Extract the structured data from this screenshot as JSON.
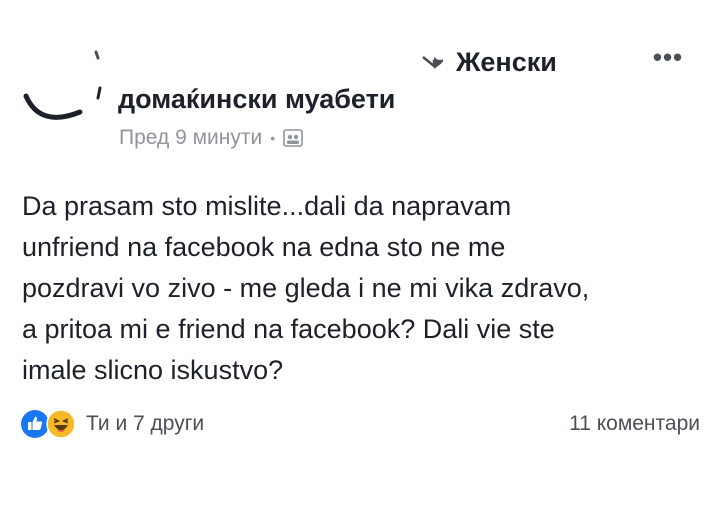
{
  "header": {
    "arrow_icon": "right-arrow-icon",
    "group_prefix": "Женски",
    "group_name": "домаќински муабети",
    "more_icon": "more-options-icon",
    "more_label": "•••"
  },
  "meta": {
    "time": "Пред 9 минути",
    "separator": "•",
    "audience_icon": "group-icon"
  },
  "post": {
    "text": "Da prasam sto mislite...dali da napravam\nunfriend na facebook na edna sto ne me\npozdravi vo zivo - me gleda i ne mi vika zdravo,\na pritoa mi e friend na facebook? Dali vie ste\nimale slicno iskustvo?"
  },
  "footer": {
    "reaction_icons": [
      "like-icon",
      "haha-icon"
    ],
    "reactions_text": "Ти и 7 други",
    "comments_text": "11 коментари"
  },
  "colors": {
    "text": "#1d2129",
    "meta": "#90949c",
    "like_blue": "#1877f2",
    "haha_yellow": "#f7b928"
  }
}
